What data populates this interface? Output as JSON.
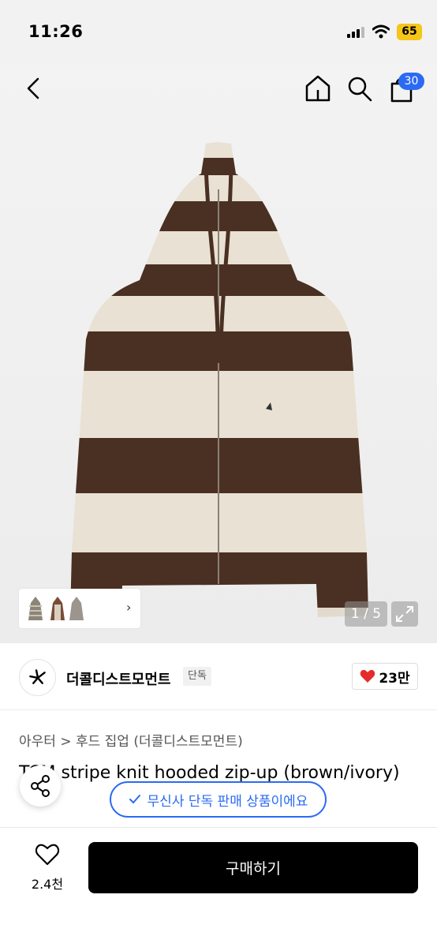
{
  "status": {
    "time": "11:26",
    "battery": "65"
  },
  "nav": {
    "cart_count": "30"
  },
  "gallery": {
    "pager": "1 / 5"
  },
  "brand": {
    "name": "더콜디스트모먼트",
    "tag": "단독",
    "likes": "23만"
  },
  "product": {
    "breadcrumb": "아우터 > 후드 집업 (더콜디스트모먼트)",
    "title": "TCM stripe knit hooded zip-up (brown/ivory)",
    "exclusive_notice": "무신사 단독 판매 상품이에요"
  },
  "bottom": {
    "wish_count": "2.4천",
    "buy_label": "구매하기"
  },
  "colors": {
    "brown": "#4a3022",
    "ivory": "#e8e1d4",
    "accent": "#2b6af3",
    "heart": "#e52b2b"
  }
}
